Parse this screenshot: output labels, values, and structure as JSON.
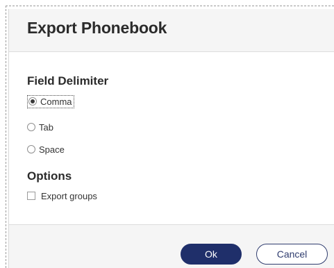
{
  "dialog": {
    "title": "Export Phonebook",
    "field_delimiter": {
      "heading": "Field Delimiter",
      "options": [
        {
          "label": "Comma",
          "selected": true
        },
        {
          "label": "Tab",
          "selected": false
        },
        {
          "label": "Space",
          "selected": false
        }
      ]
    },
    "options_section": {
      "heading": "Options",
      "export_groups": {
        "label": "Export groups",
        "checked": false
      }
    },
    "buttons": {
      "ok": "Ok",
      "cancel": "Cancel"
    }
  },
  "colors": {
    "primary": "#1f2f6a",
    "header_bg": "#f5f5f5",
    "text": "#2b2b2b"
  }
}
